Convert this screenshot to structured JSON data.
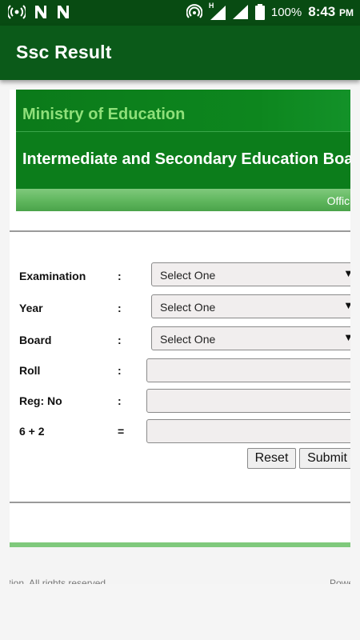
{
  "status_bar": {
    "icons_left": [
      "broadcast-icon",
      "n-icon",
      "n-icon"
    ],
    "icons_right": [
      "hotspot-icon",
      "signal-icon",
      "signal-icon",
      "battery-icon"
    ],
    "signal_label": "H",
    "battery": "100%",
    "time": "8:43",
    "ampm": "PM"
  },
  "app_bar": {
    "title": "Ssc Result"
  },
  "banner": {
    "ministry": "Ministry of Education",
    "board": "Intermediate and Secondary Education Boa",
    "official": "Officia"
  },
  "form": {
    "examination": {
      "label": "Examination",
      "colon": ":",
      "value": "Select One"
    },
    "year": {
      "label": "Year",
      "colon": ":",
      "value": "Select One"
    },
    "board": {
      "label": "Board",
      "colon": ":",
      "value": "Select One"
    },
    "roll": {
      "label": "Roll",
      "colon": ":",
      "value": ""
    },
    "reg": {
      "label": "Reg: No",
      "colon": ":",
      "value": ""
    },
    "captcha": {
      "label": "6 + 2",
      "colon": "=",
      "value": ""
    },
    "reset_label": "Reset",
    "submit_label": "Submit",
    "dropdown_arrow": "▼"
  },
  "footer": {
    "left": "ation. All rights reserved.",
    "right": "Powe"
  },
  "colors": {
    "status_bar": "#084b12",
    "app_bar": "#0b5a19",
    "banner": "#0c7d1b",
    "ministry_text": "#8fe07a",
    "stripe": "#7fc97c"
  }
}
